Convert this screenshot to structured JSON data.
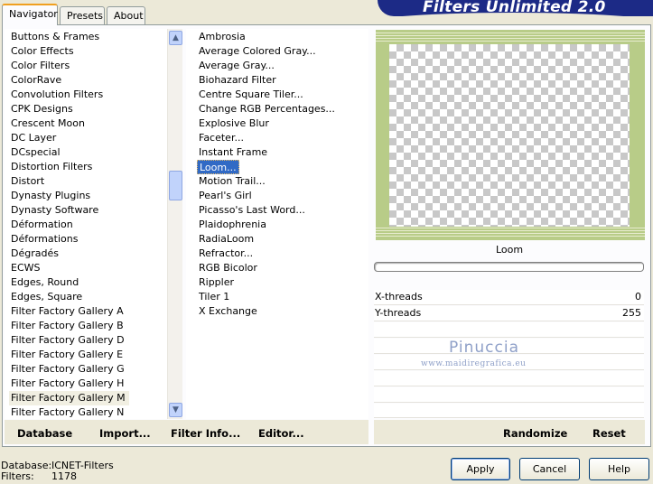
{
  "window": {
    "title": "Filters Unlimited 2.0"
  },
  "tabs": [
    {
      "label": "Navigator",
      "active": true
    },
    {
      "label": "Presets",
      "active": false
    },
    {
      "label": "About",
      "active": false
    }
  ],
  "categories": [
    "Buttons & Frames",
    "Color Effects",
    "Color Filters",
    "ColorRave",
    "Convolution Filters",
    "CPK Designs",
    "Crescent Moon",
    "DC Layer",
    "DCspecial",
    "Distortion Filters",
    "Distort",
    "Dynasty Plugins",
    "Dynasty Software",
    "Déformation",
    "Déformations",
    "Dégradés",
    "ECWS",
    "Edges, Round",
    "Edges, Square",
    "Filter Factory Gallery A",
    "Filter Factory Gallery B",
    "Filter Factory Gallery D",
    "Filter Factory Gallery E",
    "Filter Factory Gallery G",
    "Filter Factory Gallery H",
    "Filter Factory Gallery M",
    "Filter Factory Gallery N"
  ],
  "selected_category": "Filter Factory Gallery M",
  "filters": [
    "Ambrosia",
    "Average Colored Gray...",
    "Average Gray...",
    "Biohazard Filter",
    "Centre Square Tiler...",
    "Change RGB Percentages...",
    "Explosive Blur",
    "Faceter...",
    "Instant Frame",
    "Loom...",
    "Motion Trail...",
    "Pearl's Girl",
    "Picasso's Last Word...",
    "Plaidophrenia",
    "RadiaLoom",
    "Refractor...",
    "RGB Bicolor",
    "Rippler",
    "Tiler 1",
    "X Exchange"
  ],
  "selected_filter": "Loom...",
  "preview": {
    "filter_name": "Loom",
    "frame_color": "#b8cc88"
  },
  "params": [
    {
      "label": "X-threads",
      "value": "0"
    },
    {
      "label": "Y-threads",
      "value": "255"
    }
  ],
  "watermark": {
    "name": "Pinuccia",
    "url": "www.maidiregrafica.eu"
  },
  "actions": {
    "database": "Database",
    "import": "Import...",
    "filter_info": "Filter Info...",
    "editor": "Editor...",
    "randomize": "Randomize",
    "reset": "Reset"
  },
  "info": {
    "database_label": "Database:",
    "database_value": "ICNET-Filters",
    "filters_label": "Filters:",
    "filters_value": "1178"
  },
  "buttons": {
    "apply": "Apply",
    "cancel": "Cancel",
    "help": "Help"
  },
  "icons": {
    "scroll_up": "scroll-up-arrow",
    "scroll_down": "scroll-down-arrow"
  }
}
